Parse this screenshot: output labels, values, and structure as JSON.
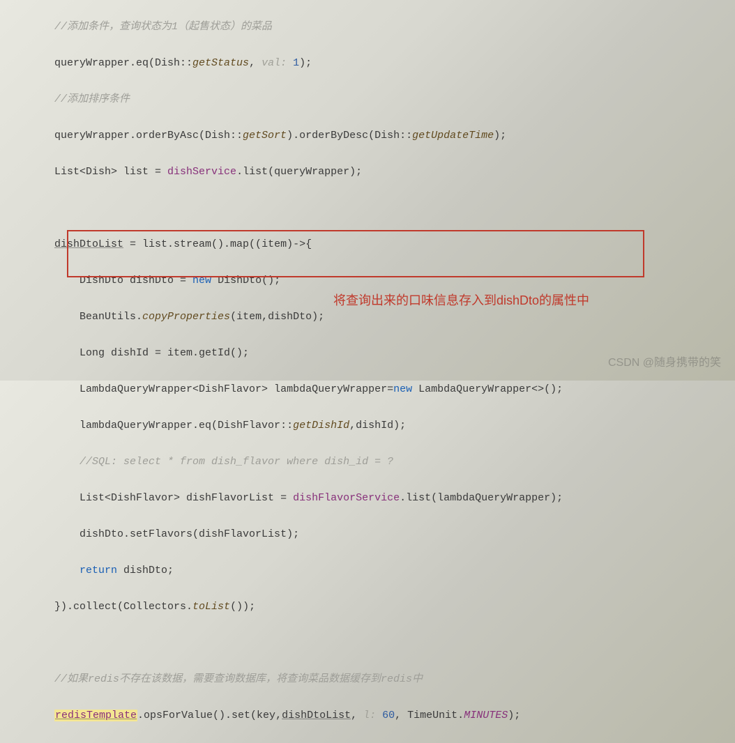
{
  "lines": {
    "l0_comment": "//添加条件，查询状态为1（起售状态）的菜品",
    "l1_a": "queryWrapper.eq(Dish::",
    "l1_b": "getStatus",
    "l1_c": ", ",
    "l1_hint": "val: ",
    "l1_d": "1",
    "l1_e": ");",
    "l2_comment": "//添加排序条件",
    "l3_a": "queryWrapper.orderByAsc(Dish::",
    "l3_b": "getSort",
    "l3_c": ").orderByDesc(Dish::",
    "l3_d": "getUpdateTime",
    "l3_e": ");",
    "l4_a": "List<Dish> list = ",
    "l4_b": "dishService",
    "l4_c": ".list(queryWrapper);",
    "l5_a": "dishDtoList",
    "l5_b": " = list.stream().map((item)->{",
    "l6_a": "DishDto dishDto = ",
    "l6_b": "new",
    "l6_c": " DishDto();",
    "l7_a": "BeanUtils.",
    "l7_b": "copyProperties",
    "l7_c": "(item,dishDto);",
    "l8_a": "Long dishId = item.getId();",
    "l9_a": "LambdaQueryWrapper<DishFlavor> lambdaQueryWrapper=",
    "l9_b": "new",
    "l9_c": " LambdaQueryWrapper<>();",
    "l10_a": "lambdaQueryWrapper.eq(DishFlavor::",
    "l10_b": "getDishId",
    "l10_c": ",dishId);",
    "l11_comment": "//SQL: select * from dish_flavor where dish_id = ?",
    "l12_a": "List<DishFlavor> dishFlavorList = ",
    "l12_b": "dishFlavorService",
    "l12_c": ".list(lambdaQueryWrapper);",
    "l13_a": "dishDto.setFlavors(dishFlavorList);",
    "l14_a": "return",
    "l14_b": " dishDto;",
    "l15_a": "}).collect(Collectors.",
    "l15_b": "toList",
    "l15_c": "());",
    "l16_comment_a": "//如果redis",
    "l16_comment_b": "不存在该数据，需要查询数据库，将查询菜品数据缓存到redis中",
    "l17_a": "redisTemplate",
    "l17_b": ".opsForValue().set(key,",
    "l17_c": "dishDtoList",
    "l17_d": ", ",
    "l17_hint": "l: ",
    "l17_e": "60",
    "l17_f": ", TimeUnit.",
    "l17_g": "MINUTES",
    "l17_h": ");"
  },
  "annotation": "将查询出来的口味信息存入到dishDto的属性中",
  "watermark": "CSDN @随身携带的笑"
}
